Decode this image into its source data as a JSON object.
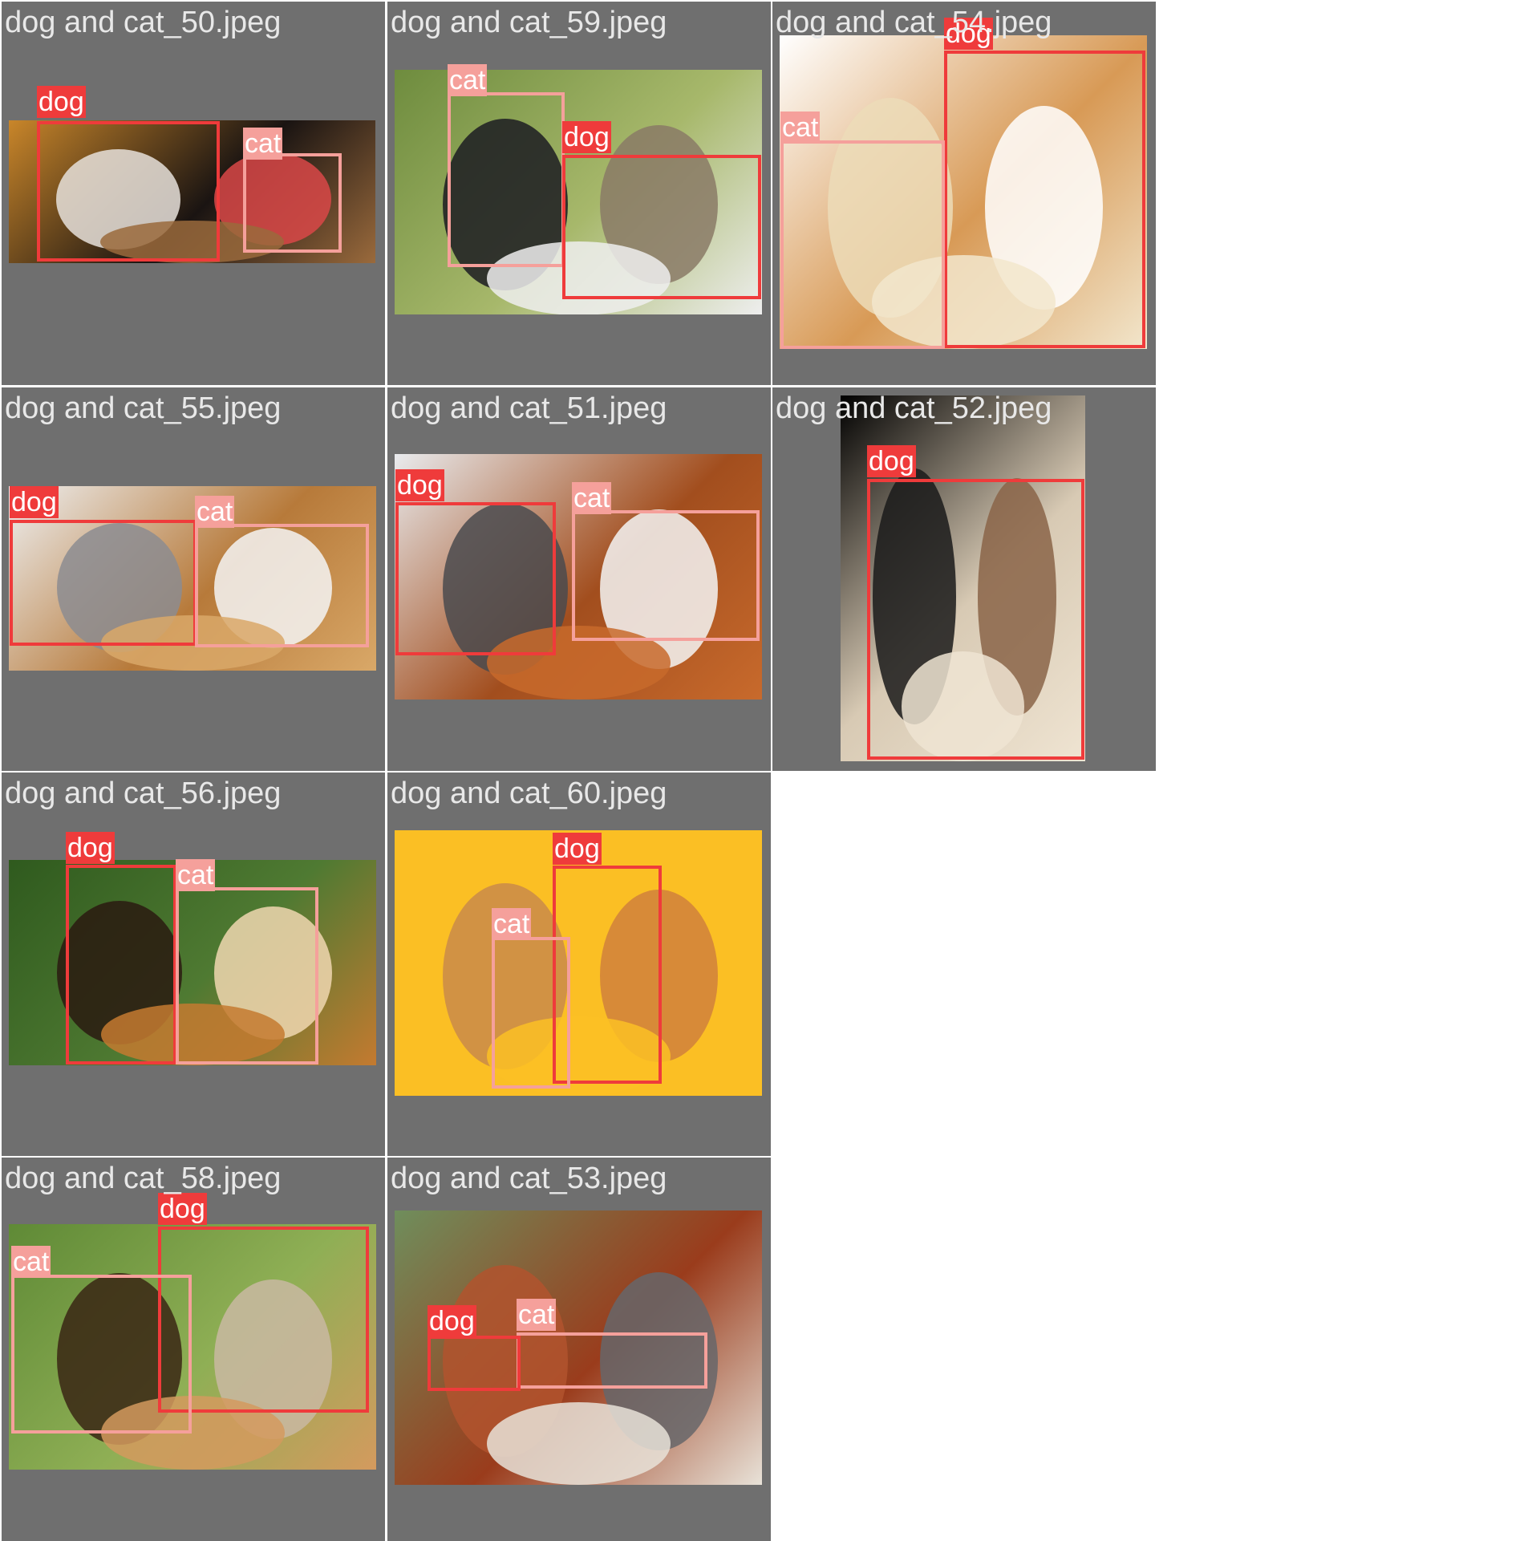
{
  "colors": {
    "tile_background": "#6f6f6f",
    "dog_box": "#ef3b3b",
    "cat_box": "#f5a09b",
    "title_text": "#e8e8e8"
  },
  "tiles": [
    {
      "title": "dog and cat_50.jpeg",
      "photo_colors": [
        "#c9862a",
        "#1a1412",
        "#e6e0da",
        "#d94848",
        "#9a6a3c"
      ],
      "detections": [
        {
          "label": "dog"
        },
        {
          "label": "cat"
        }
      ]
    },
    {
      "title": "dog and cat_59.jpeg",
      "photo_colors": [
        "#6e8c3e",
        "#a7b86b",
        "#1c1c22",
        "#8a7a66",
        "#eeeeee"
      ],
      "detections": [
        {
          "label": "cat"
        },
        {
          "label": "dog"
        }
      ]
    },
    {
      "title": "dog and cat_54.jpeg",
      "photo_colors": [
        "#ffffff",
        "#d89a56",
        "#ecdcb8",
        "#ffffff",
        "#f2e6cc"
      ],
      "detections": [
        {
          "label": "dog"
        },
        {
          "label": "cat"
        }
      ]
    },
    {
      "title": "dog and cat_55.jpeg",
      "photo_colors": [
        "#eef0f2",
        "#b77a3a",
        "#8c8c90",
        "#f4f4f4",
        "#d9a868"
      ],
      "detections": [
        {
          "label": "dog"
        },
        {
          "label": "cat"
        }
      ]
    },
    {
      "title": "dog and cat_51.jpeg",
      "photo_colors": [
        "#e9ebee",
        "#a24e1e",
        "#4a4a4e",
        "#f5f5f5",
        "#c86a2c"
      ],
      "detections": [
        {
          "label": "dog"
        },
        {
          "label": "cat"
        }
      ]
    },
    {
      "title": "dog and cat_52.jpeg",
      "photo_colors": [
        "#000000",
        "#d8cab4",
        "#1a1a1a",
        "#8a6448",
        "#efe4d2"
      ],
      "detections": [
        {
          "label": "dog"
        }
      ]
    },
    {
      "title": "dog and cat_56.jpeg",
      "photo_colors": [
        "#2f5a1e",
        "#4f7a32",
        "#2a1a10",
        "#f0d7b0",
        "#c47a30"
      ],
      "detections": [
        {
          "label": "dog"
        },
        {
          "label": "cat"
        }
      ]
    },
    {
      "title": "dog and cat_60.jpeg",
      "photo_colors": [
        "#fbbf24",
        "#fbbf24",
        "#c98a4a",
        "#d0803c",
        "#fbbf24"
      ],
      "detections": [
        {
          "label": "dog"
        },
        {
          "label": "cat"
        }
      ]
    },
    {
      "title": "dog and cat_58.jpeg",
      "photo_colors": [
        "#5f8a36",
        "#8faf55",
        "#3a2614",
        "#c9b9a2",
        "#d49a5e"
      ],
      "detections": [
        {
          "label": "dog"
        },
        {
          "label": "cat"
        }
      ]
    },
    {
      "title": "dog and cat_53.jpeg",
      "photo_colors": [
        "#6f8e5c",
        "#9a3c1c",
        "#b2532e",
        "#66666a",
        "#e8e2d8"
      ],
      "detections": [
        {
          "label": "cat"
        },
        {
          "label": "dog"
        }
      ]
    }
  ]
}
